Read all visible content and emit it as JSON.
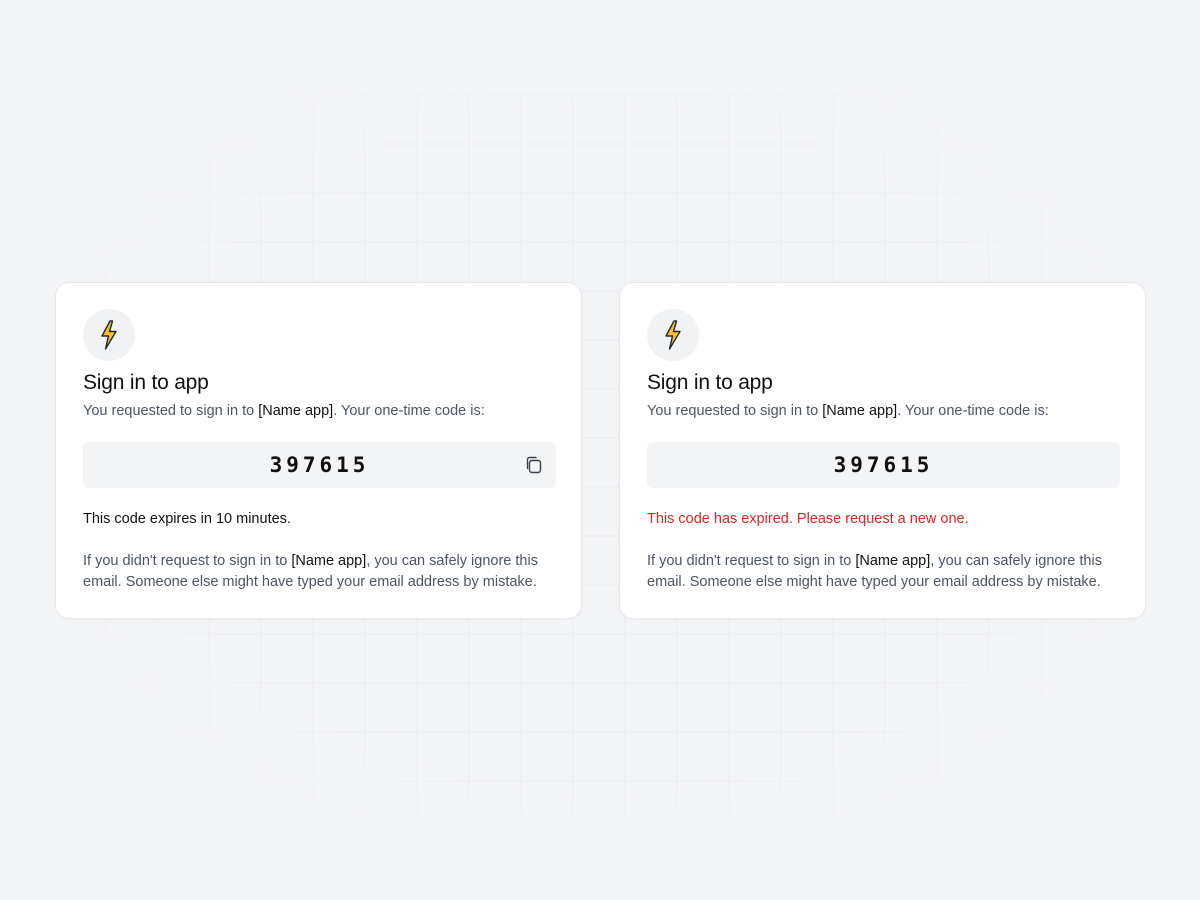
{
  "cards": [
    {
      "icon": "lightning-bolt-icon",
      "title": "Sign in to app",
      "subtitle_pre": "You requested to sign in to ",
      "subtitle_app": "[Name app]",
      "subtitle_post": ". Your one-time code is:",
      "code": "397615",
      "copy_icon": "copy-icon",
      "status": "This code expires in 10 minutes.",
      "disclaimer_pre": "If you didn't request to sign in to ",
      "disclaimer_app": "[Name app]",
      "disclaimer_post": ", you can safely ignore this email. Someone else might have typed your email address by mistake."
    },
    {
      "icon": "lightning-bolt-icon",
      "title": "Sign in to app",
      "subtitle_pre": "You requested to sign in to ",
      "subtitle_app": "[Name app]",
      "subtitle_post": ". Your one-time code is:",
      "code": "397615",
      "status": "This code has expired. Please request a new one.",
      "disclaimer_pre": "If you didn't request to sign in to ",
      "disclaimer_app": "[Name app]",
      "disclaimer_post": ", you can safely ignore this email. Someone else might have typed your email address by mistake."
    }
  ],
  "colors": {
    "background": "#f3f4f6",
    "card": "#ffffff",
    "bolt": "#fbbf24",
    "expired": "#dc2626"
  }
}
